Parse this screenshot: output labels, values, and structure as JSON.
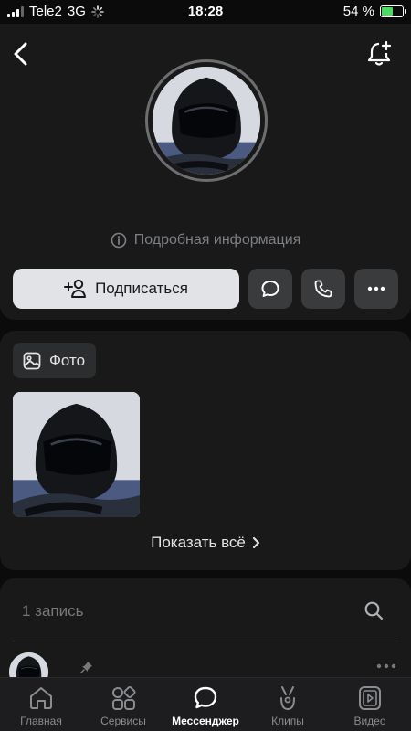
{
  "status_bar": {
    "carrier": "Tele2",
    "network": "3G",
    "time": "18:28",
    "battery": "54 %",
    "battery_level": 0.54
  },
  "header": {
    "back_icon": "chevron-left-icon",
    "bell_icon": "bell-plus-icon"
  },
  "profile": {
    "info_link": "Подробная информация",
    "info_icon": "info-circle-icon"
  },
  "actions": {
    "subscribe_label": "Подписаться",
    "subscribe_icon": "add-user-icon",
    "message_icon": "message-icon",
    "call_icon": "phone-icon",
    "more_icon": "more-horizontal-icon"
  },
  "photos": {
    "chip_label": "Фото",
    "chip_icon": "photo-icon",
    "show_all": "Показать всё"
  },
  "posts": {
    "count_label": "1 запись",
    "search_icon": "search-icon"
  },
  "tabbar": {
    "items": [
      {
        "label": "Главная",
        "icon": "home-icon",
        "active": false
      },
      {
        "label": "Сервисы",
        "icon": "services-grid-icon",
        "active": false
      },
      {
        "label": "Мессенджер",
        "icon": "messenger-icon",
        "active": true
      },
      {
        "label": "Клипы",
        "icon": "clips-icon",
        "active": false
      },
      {
        "label": "Видео",
        "icon": "video-icon",
        "active": false
      }
    ]
  },
  "colors": {
    "background": "#0b0b0c",
    "card": "#19191a",
    "accent_button": "#e1e3e6",
    "secondary_button": "#3a3b3d",
    "battery_fill": "#4cd964"
  }
}
